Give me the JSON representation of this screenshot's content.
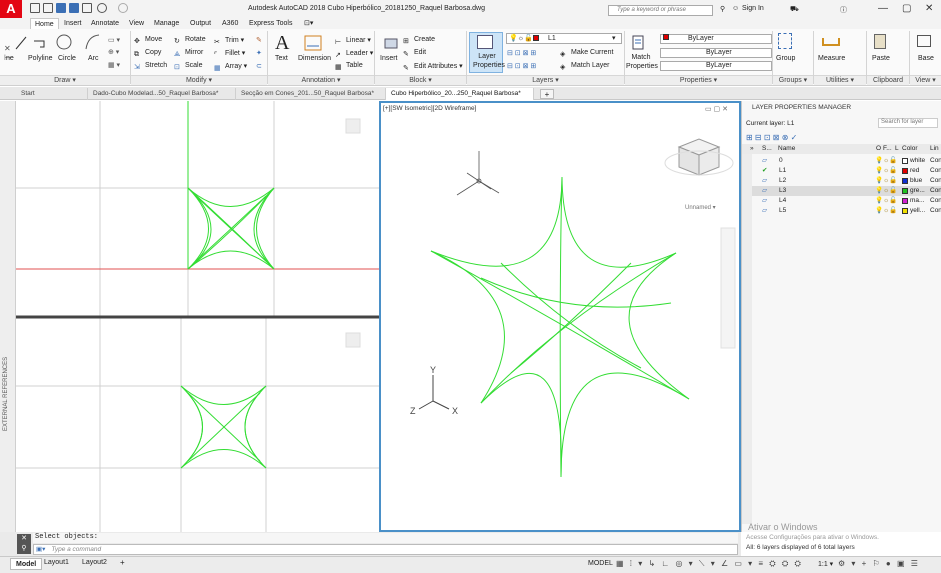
{
  "app": {
    "logo": "A",
    "title": "Autodesk AutoCAD 2018   Cubo Hiperbólico_20181250_Raquel Barbosa.dwg"
  },
  "titlebar": {
    "search_placeholder": "Type a keyword or phrase",
    "sign_in": "Sign In",
    "minimize": "—",
    "restore": "▢",
    "close": "✕"
  },
  "ribbon_tabs": [
    "Home",
    "Insert",
    "Annotate",
    "View",
    "Manage",
    "Output",
    "A360",
    "Express Tools",
    "⊡▾"
  ],
  "draw": {
    "line": "ne",
    "polyline": "Polyline",
    "circle": "Circle",
    "arc": "Arc",
    "panel": "Draw ▾"
  },
  "modify": {
    "move": "Move",
    "rotate": "Rotate",
    "trim": "Trim ▾",
    "copy": "Copy",
    "mirror": "Mirror",
    "fillet": "Fillet ▾",
    "stretch": "Stretch",
    "scale": "Scale",
    "array": "Array ▾",
    "panel": "Modify ▾"
  },
  "annotation": {
    "text": "Text",
    "dimension": "Dimension",
    "linear": "Linear ▾",
    "leader": "Leader ▾",
    "table": "Table",
    "panel": "Annotation ▾"
  },
  "block": {
    "insert": "Insert",
    "create": "Create",
    "edit": "Edit",
    "edit_attributes": "Edit Attributes ▾",
    "panel": "Block ▾"
  },
  "layers": {
    "current": "L1",
    "layer_properties": "Layer Properties",
    "make_current": "Make Current",
    "match_layer": "Match Layer",
    "panel": "Layers ▾"
  },
  "properties": {
    "match": "Match Properties",
    "color": "ByLayer",
    "linetype": "ByLayer",
    "lineweight": "ByLayer",
    "panel": "Properties ▾"
  },
  "groups": {
    "group": "Group",
    "panel": "Groups ▾"
  },
  "utilities": {
    "measure": "Measure",
    "panel": "Utilities ▾"
  },
  "clipboard": {
    "paste": "Paste",
    "panel": "Clipboard"
  },
  "view": {
    "base": "Base",
    "panel": "View ▾"
  },
  "doc_tabs": [
    "Start",
    "Dado-Cubo Modelad...50_Raquel Barbosa*",
    "Secção em Cones_201...50_Raquel Barbosa*",
    "Cubo Hiperbólico_20...250_Raquel Barbosa*"
  ],
  "viewport": {
    "label": "[+][SW Isometric][2D Wireframe]",
    "viewcube_label": "Unnamed ▾",
    "axis_x": "X",
    "axis_y": "Y",
    "axis_z": "Z"
  },
  "side_label": "EXTERNAL REFERENCES",
  "lpm": {
    "title": "LAYER PROPERTIES MANAGER",
    "current": "Current layer: L1",
    "search": "Search for layer",
    "headers": [
      "S...",
      "Name",
      "O",
      "F...",
      "L",
      "Color",
      "Lin"
    ],
    "layers": [
      {
        "name": "0",
        "color_name": "white",
        "color": "#ffffff",
        "lt": "Con"
      },
      {
        "name": "L1",
        "color_name": "red",
        "color": "#e00000",
        "lt": "Con",
        "current": true
      },
      {
        "name": "L2",
        "color_name": "blue",
        "color": "#1030d0",
        "lt": "Con"
      },
      {
        "name": "L3",
        "color_name": "gre...",
        "color": "#20c020",
        "lt": "Con",
        "selected": true
      },
      {
        "name": "L4",
        "color_name": "ma...",
        "color": "#d020d0",
        "lt": "Con"
      },
      {
        "name": "L5",
        "color_name": "yell...",
        "color": "#f0e000",
        "lt": "Con"
      }
    ],
    "watermark1": "Ativar o Windows",
    "watermark2": "Acesse Configurações para ativar o Windows.",
    "footer": "All: 6 layers displayed of 6 total layers"
  },
  "cmd": {
    "prompt": "Select objects:",
    "placeholder": "Type a command"
  },
  "layout_tabs": [
    "Model",
    "Layout1",
    "Layout2",
    "+"
  ],
  "status": {
    "model": "MODEL",
    "scale": "1:1 ▾"
  },
  "colors": {
    "geometry": "#33dd33",
    "viewport_border": "#4a90c8",
    "red_line": "#e05050"
  }
}
